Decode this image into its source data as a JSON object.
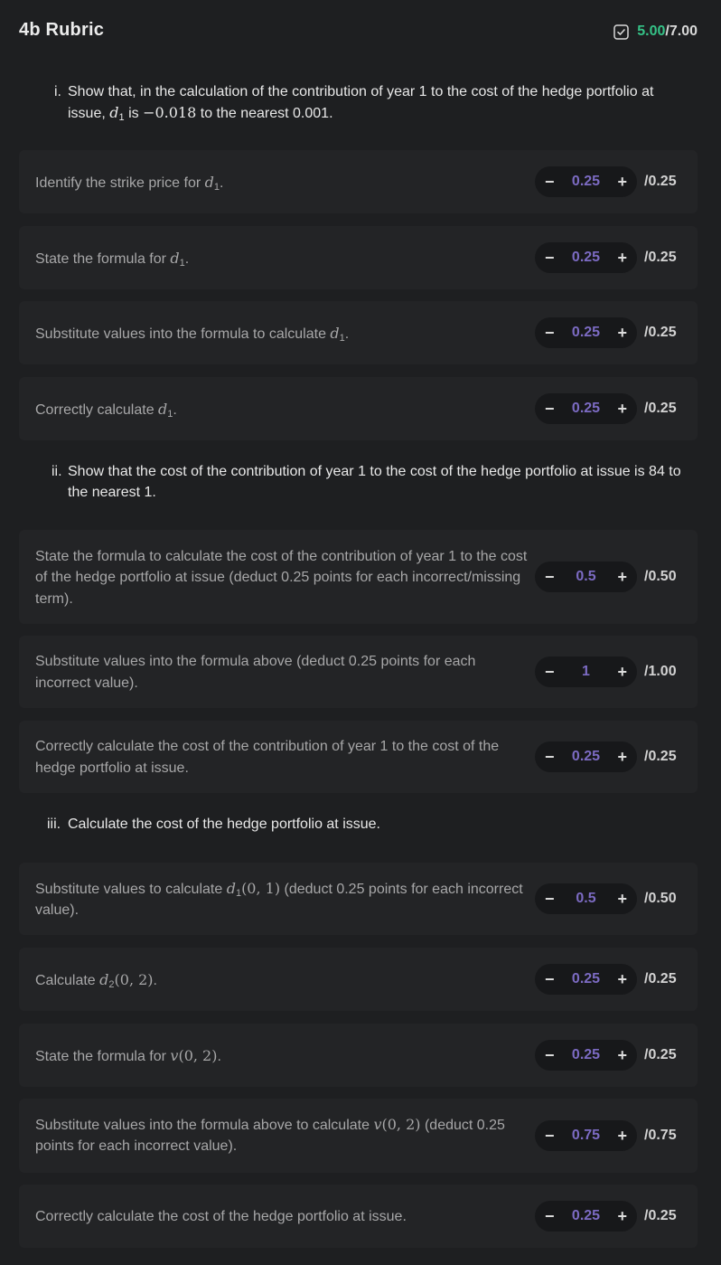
{
  "header": {
    "title": "4b Rubric",
    "score_earned": "5.00",
    "score_total": "/7.00",
    "icon": "checkbox-check-icon",
    "accent": "#35c287"
  },
  "questions": [
    {
      "num": "i.",
      "pre": "Show that, in the calculation of the contribution of year 1 to the cost of the hedge portfolio at issue, ",
      "var": "d",
      "sub": "1",
      "mid": " is ",
      "val": "−0.018",
      "post": " to the nearest 0.001."
    },
    {
      "num": "ii.",
      "text": "Show that the cost of the contribution of year 1 to the cost of the hedge portfolio at issue is 84 to the nearest 1."
    },
    {
      "num": "iii.",
      "text": "Calculate the cost of the hedge portfolio at issue."
    }
  ],
  "criteria": [
    {
      "pre": "Identify the strike price for ",
      "var": "d",
      "sub": "1",
      "args": "",
      "post": ".",
      "value": "0.25",
      "max": "/0.25"
    },
    {
      "pre": "State the formula for ",
      "var": "d",
      "sub": "1",
      "args": "",
      "post": ".",
      "value": "0.25",
      "max": "/0.25"
    },
    {
      "pre": "Substitute values into the formula to calculate ",
      "var": "d",
      "sub": "1",
      "args": "",
      "post": ".",
      "value": "0.25",
      "max": "/0.25"
    },
    {
      "pre": "Correctly calculate ",
      "var": "d",
      "sub": "1",
      "args": "",
      "post": ".",
      "value": "0.25",
      "max": "/0.25"
    },
    {
      "pre": "State the formula to calculate the cost of the contribution of year 1 to the cost of the hedge portfolio at issue (deduct 0.25 points for each incorrect/missing term).",
      "var": "",
      "sub": "",
      "args": "",
      "post": "",
      "value": "0.5",
      "max": "/0.50"
    },
    {
      "pre": "Substitute values into the formula above (deduct 0.25 points for each incorrect value).",
      "var": "",
      "sub": "",
      "args": "",
      "post": "",
      "value": "1",
      "max": "/1.00"
    },
    {
      "pre": "Correctly calculate the cost of the contribution of year 1 to the cost of the hedge portfolio at issue.",
      "var": "",
      "sub": "",
      "args": "",
      "post": "",
      "value": "0.25",
      "max": "/0.25"
    },
    {
      "pre": "Substitute values to calculate ",
      "var": "d",
      "sub": "1",
      "args": "(0, 1)",
      "post": " (deduct 0.25 points for each incorrect value).",
      "value": "0.5",
      "max": "/0.50"
    },
    {
      "pre": "Calculate ",
      "var": "d",
      "sub": "2",
      "args": "(0, 2)",
      "post": ".",
      "value": "0.25",
      "max": "/0.25"
    },
    {
      "pre": "State the formula for ",
      "var": "v",
      "sub": "",
      "args": "(0, 2)",
      "post": ".",
      "value": "0.25",
      "max": "/0.25"
    },
    {
      "pre": "Substitute values into the formula above to calculate ",
      "var": "v",
      "sub": "",
      "args": "(0, 2)",
      "post": " (deduct 0.25 points for each incorrect value).",
      "value": "0.75",
      "max": "/0.75"
    },
    {
      "pre": "Correctly calculate the cost of the hedge portfolio at issue.",
      "var": "",
      "sub": "",
      "args": "",
      "post": "",
      "value": "0.25",
      "max": "/0.25"
    }
  ],
  "stepper": {
    "minus_label": "−",
    "plus_label": "+"
  },
  "colors": {
    "background": "#1e1f21",
    "card": "#232426",
    "value": "#7c6bc3"
  }
}
